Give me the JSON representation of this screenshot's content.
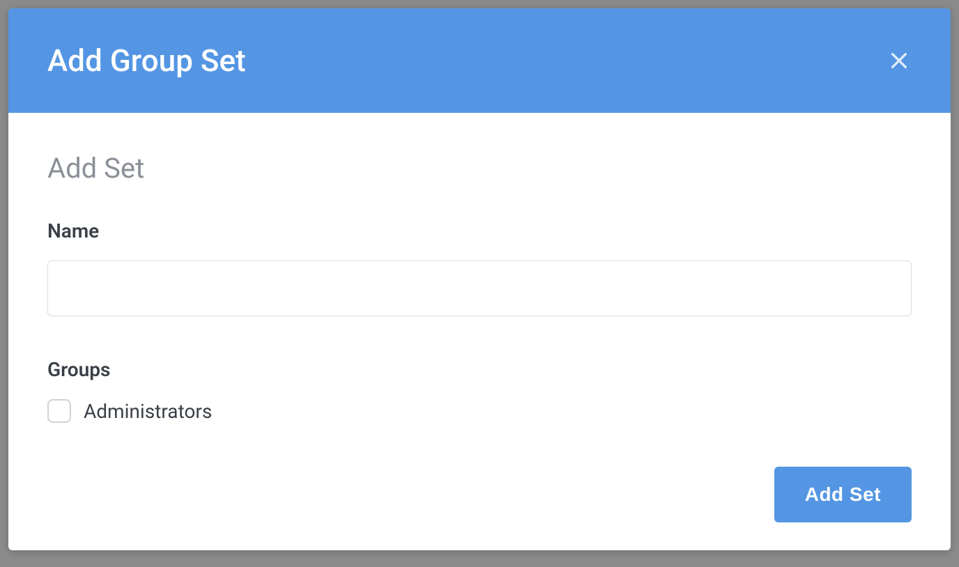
{
  "modal": {
    "title": "Add Group Set",
    "close_icon": "close-icon"
  },
  "form": {
    "section_title": "Add Set",
    "name_label": "Name",
    "name_value": "",
    "name_placeholder": "",
    "groups_label": "Groups",
    "groups": [
      {
        "label": "Administrators",
        "checked": false
      }
    ],
    "submit_label": "Add Set"
  },
  "colors": {
    "header_bg": "#5496e3",
    "primary_btn": "#5496e3",
    "muted_title": "#8a8f98",
    "label": "#3a3f47",
    "border": "#dcdde0"
  }
}
